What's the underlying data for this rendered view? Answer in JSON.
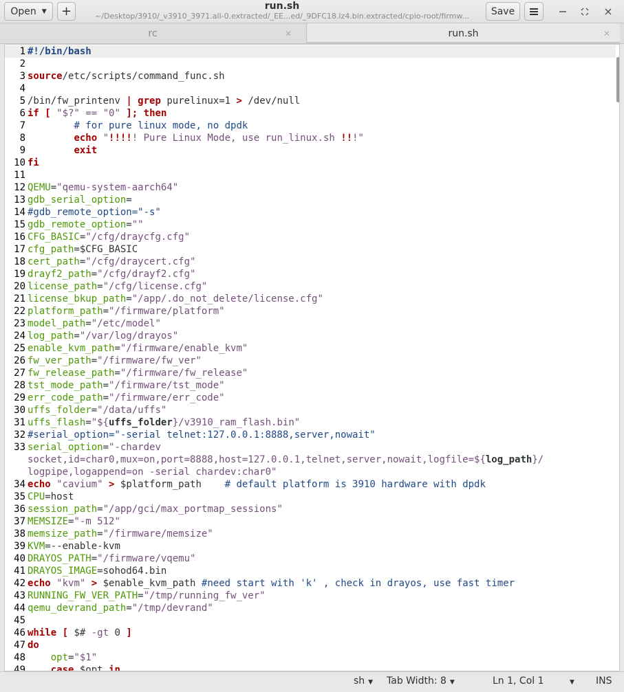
{
  "header": {
    "open_label": "Open",
    "new_tab_label": "+",
    "title": "run.sh",
    "subtitle": "~/Desktop/3910/_v3910_3971.all-0.extracted/_EE...ed/_9DFC18.lz4.bin.extracted/cpio-root/firmw...",
    "save_label": "Save",
    "minimize_glyph": "—",
    "maximize_glyph": "⁺⁄₊",
    "close_glyph": "✕"
  },
  "tabs": [
    {
      "label": "rc",
      "close": "✕"
    },
    {
      "label": "run.sh",
      "close": "✕"
    }
  ],
  "code_lines": [
    {
      "n": "1",
      "segs": [
        [
          "bl",
          "#!/bin/bash"
        ]
      ]
    },
    {
      "n": "2",
      "segs": []
    },
    {
      "n": "3",
      "segs": [
        [
          "kw",
          "source"
        ],
        [
          "",
          "/etc/scripts/command_func.sh"
        ]
      ]
    },
    {
      "n": "4",
      "segs": []
    },
    {
      "n": "5",
      "segs": [
        [
          "",
          "/bin/"
        ],
        [
          "",
          "fw_printenv "
        ],
        [
          "kw",
          "|"
        ],
        [
          "",
          ""
        ],
        [
          "kw",
          " grep"
        ],
        [
          "",
          " purelinux=1 "
        ],
        [
          "kw",
          ">"
        ],
        [
          "",
          " /dev/null"
        ]
      ]
    },
    {
      "n": "6",
      "segs": [
        [
          "kw",
          "if"
        ],
        [
          "",
          " "
        ],
        [
          "kw",
          "["
        ],
        [
          "",
          " "
        ],
        [
          "st",
          "\"$?\""
        ],
        [
          "",
          " "
        ],
        [
          "st",
          "=="
        ],
        [
          "",
          " "
        ],
        [
          "st",
          "\"0\""
        ],
        [
          "",
          " "
        ],
        [
          "kw",
          "];"
        ],
        [
          "",
          " "
        ],
        [
          "kw",
          "then"
        ]
      ]
    },
    {
      "n": "7",
      "segs": [
        [
          "",
          "        "
        ],
        [
          "cm",
          "# for pure linux mode, no dpdk"
        ]
      ]
    },
    {
      "n": "8",
      "segs": [
        [
          "",
          "        "
        ],
        [
          "kw",
          "echo"
        ],
        [
          "",
          " "
        ],
        [
          "st",
          "\""
        ],
        [
          "kw",
          "!!!!"
        ],
        [
          "st",
          "! Pure Linux Mode, use run_linux.sh "
        ],
        [
          "kw",
          "!!"
        ],
        [
          "st",
          "!\""
        ]
      ]
    },
    {
      "n": "9",
      "segs": [
        [
          "",
          "        "
        ],
        [
          "kw",
          "exit"
        ]
      ]
    },
    {
      "n": "10",
      "segs": [
        [
          "kw",
          "fi"
        ]
      ]
    },
    {
      "n": "11",
      "segs": []
    },
    {
      "n": "12",
      "segs": [
        [
          "vr",
          "QEMU"
        ],
        [
          "",
          "="
        ],
        [
          "st",
          "\"qemu-system-aarch64\""
        ]
      ]
    },
    {
      "n": "13",
      "segs": [
        [
          "vr",
          "gdb_serial_option"
        ],
        [
          "",
          "="
        ]
      ]
    },
    {
      "n": "14",
      "segs": [
        [
          "cm",
          "#gdb_remote_option=\"-s\""
        ]
      ]
    },
    {
      "n": "15",
      "segs": [
        [
          "vr",
          "gdb_remote_option"
        ],
        [
          "",
          "="
        ],
        [
          "st",
          "\"\""
        ]
      ]
    },
    {
      "n": "16",
      "segs": [
        [
          "vr",
          "CFG_BASIC"
        ],
        [
          "",
          "="
        ],
        [
          "st",
          "\"/cfg/draycfg.cfg\""
        ]
      ]
    },
    {
      "n": "17",
      "segs": [
        [
          "vr",
          "cfg_path"
        ],
        [
          "",
          "=$CFG_BASIC"
        ]
      ]
    },
    {
      "n": "18",
      "segs": [
        [
          "vr",
          "cert_path"
        ],
        [
          "",
          "="
        ],
        [
          "st",
          "\"/cfg/draycert.cfg\""
        ]
      ]
    },
    {
      "n": "19",
      "segs": [
        [
          "vr",
          "drayf2_path"
        ],
        [
          "",
          "="
        ],
        [
          "st",
          "\"/cfg/drayf2.cfg\""
        ]
      ]
    },
    {
      "n": "20",
      "segs": [
        [
          "vr",
          "license_path"
        ],
        [
          "",
          "="
        ],
        [
          "st",
          "\"/cfg/license.cfg\""
        ]
      ]
    },
    {
      "n": "21",
      "segs": [
        [
          "vr",
          "license_bkup_path"
        ],
        [
          "",
          "="
        ],
        [
          "st",
          "\"/app/.do_not_delete/license.cfg\""
        ]
      ]
    },
    {
      "n": "22",
      "segs": [
        [
          "vr",
          "platform_path"
        ],
        [
          "",
          "="
        ],
        [
          "st",
          "\"/firmware/platform\""
        ]
      ]
    },
    {
      "n": "23",
      "segs": [
        [
          "vr",
          "model_path"
        ],
        [
          "",
          "="
        ],
        [
          "st",
          "\"/etc/model\""
        ]
      ]
    },
    {
      "n": "24",
      "segs": [
        [
          "vr",
          "log_path"
        ],
        [
          "",
          "="
        ],
        [
          "st",
          "\"/var/log/drayos\""
        ]
      ]
    },
    {
      "n": "25",
      "segs": [
        [
          "vr",
          "enable_kvm_path"
        ],
        [
          "",
          "="
        ],
        [
          "st",
          "\"/firmware/enable_kvm\""
        ]
      ]
    },
    {
      "n": "26",
      "segs": [
        [
          "vr",
          "fw_ver_path"
        ],
        [
          "",
          "="
        ],
        [
          "st",
          "\"/firmware/fw_ver\""
        ]
      ]
    },
    {
      "n": "27",
      "segs": [
        [
          "vr",
          "fw_release_path"
        ],
        [
          "",
          "="
        ],
        [
          "st",
          "\"/firmware/fw_release\""
        ]
      ]
    },
    {
      "n": "28",
      "segs": [
        [
          "vr",
          "tst_mode_path"
        ],
        [
          "",
          "="
        ],
        [
          "st",
          "\"/firmware/tst_mode\""
        ]
      ]
    },
    {
      "n": "29",
      "segs": [
        [
          "vr",
          "err_code_path"
        ],
        [
          "",
          "="
        ],
        [
          "st",
          "\"/firmware/err_code\""
        ]
      ]
    },
    {
      "n": "30",
      "segs": [
        [
          "vr",
          "uffs_folder"
        ],
        [
          "",
          "="
        ],
        [
          "st",
          "\"/data/uffs\""
        ]
      ]
    },
    {
      "n": "31",
      "segs": [
        [
          "vr",
          "uffs_flash"
        ],
        [
          "",
          "="
        ],
        [
          "st",
          "\"${"
        ],
        [
          "bi",
          "uffs_folder"
        ],
        [
          "st",
          "}/v3910_ram_flash.bin\""
        ]
      ]
    },
    {
      "n": "32",
      "segs": [
        [
          "cm",
          "#serial_option=\"-serial telnet:127.0.0.1:8888,server,nowait\""
        ]
      ]
    },
    {
      "n": "33",
      "segs": [
        [
          "vr",
          "serial_option"
        ],
        [
          "",
          "="
        ],
        [
          "st",
          "\"-chardev"
        ]
      ]
    },
    {
      "n": "",
      "segs": [
        [
          "st",
          "socket,id=char0,mux=on,port=8888,host=127.0.0.1,telnet,server,nowait,logfile=${"
        ],
        [
          "bi",
          "log_path"
        ],
        [
          "st",
          "}/"
        ]
      ]
    },
    {
      "n": "",
      "segs": [
        [
          "st",
          "logpipe,logappend=on -serial chardev:char0\""
        ]
      ]
    },
    {
      "n": "34",
      "segs": [
        [
          "kw",
          "echo"
        ],
        [
          "",
          " "
        ],
        [
          "st",
          "\"cavium\""
        ],
        [
          "",
          " "
        ],
        [
          "kw",
          ">"
        ],
        [
          "",
          " $platform_path    "
        ],
        [
          "cm",
          "# default platform is 3910 hardware with dpdk"
        ]
      ]
    },
    {
      "n": "35",
      "segs": [
        [
          "vr",
          "CPU"
        ],
        [
          "",
          "=host"
        ]
      ]
    },
    {
      "n": "36",
      "segs": [
        [
          "vr",
          "session_path"
        ],
        [
          "",
          "="
        ],
        [
          "st",
          "\"/app/gci/max_portmap_sessions\""
        ]
      ]
    },
    {
      "n": "37",
      "segs": [
        [
          "vr",
          "MEMSIZE"
        ],
        [
          "",
          "="
        ],
        [
          "st",
          "\"-m 512\""
        ]
      ]
    },
    {
      "n": "38",
      "segs": [
        [
          "vr",
          "memsize_path"
        ],
        [
          "",
          "="
        ],
        [
          "st",
          "\"/firmware/memsize\""
        ]
      ]
    },
    {
      "n": "39",
      "segs": [
        [
          "vr",
          "KVM"
        ],
        [
          "",
          "=--enable-kvm"
        ]
      ]
    },
    {
      "n": "40",
      "segs": [
        [
          "vr",
          "DRAYOS_PATH"
        ],
        [
          "",
          "="
        ],
        [
          "st",
          "\"/firmware/vqemu\""
        ]
      ]
    },
    {
      "n": "41",
      "segs": [
        [
          "vr",
          "DRAYOS_IMAGE"
        ],
        [
          "",
          "=sohod64.bin"
        ]
      ]
    },
    {
      "n": "42",
      "segs": [
        [
          "kw",
          "echo"
        ],
        [
          "",
          " "
        ],
        [
          "st",
          "\"kvm\""
        ],
        [
          "",
          " "
        ],
        [
          "kw",
          ">"
        ],
        [
          "",
          " $enable_kvm_path "
        ],
        [
          "cm",
          "#need start with 'k' , check in drayos, use fast timer"
        ]
      ]
    },
    {
      "n": "43",
      "segs": [
        [
          "vr",
          "RUNNING_FW_VER_PATH"
        ],
        [
          "",
          "="
        ],
        [
          "st",
          "\"/tmp/running_fw_ver\""
        ]
      ]
    },
    {
      "n": "44",
      "segs": [
        [
          "vr",
          "qemu_devrand_path"
        ],
        [
          "",
          "="
        ],
        [
          "st",
          "\"/tmp/devrand\""
        ]
      ]
    },
    {
      "n": "45",
      "segs": []
    },
    {
      "n": "46",
      "segs": [
        [
          "kw",
          "while"
        ],
        [
          "",
          " "
        ],
        [
          "kw",
          "["
        ],
        [
          "",
          " $# "
        ],
        [
          "st",
          "-gt"
        ],
        [
          "",
          " 0 "
        ],
        [
          "kw",
          "]"
        ]
      ]
    },
    {
      "n": "47",
      "segs": [
        [
          "kw",
          "do"
        ]
      ]
    },
    {
      "n": "48",
      "segs": [
        [
          "",
          "    "
        ],
        [
          "vr",
          "opt"
        ],
        [
          "",
          "="
        ],
        [
          "st",
          "\"$1\""
        ]
      ]
    },
    {
      "n": "49",
      "segs": [
        [
          "",
          "    "
        ],
        [
          "kw",
          "case"
        ],
        [
          "",
          " $opt "
        ],
        [
          "kw",
          "in"
        ]
      ]
    }
  ],
  "status": {
    "language": "sh",
    "tab_width": "Tab Width: 8",
    "position": "Ln 1, Col 1",
    "mode": "INS"
  }
}
